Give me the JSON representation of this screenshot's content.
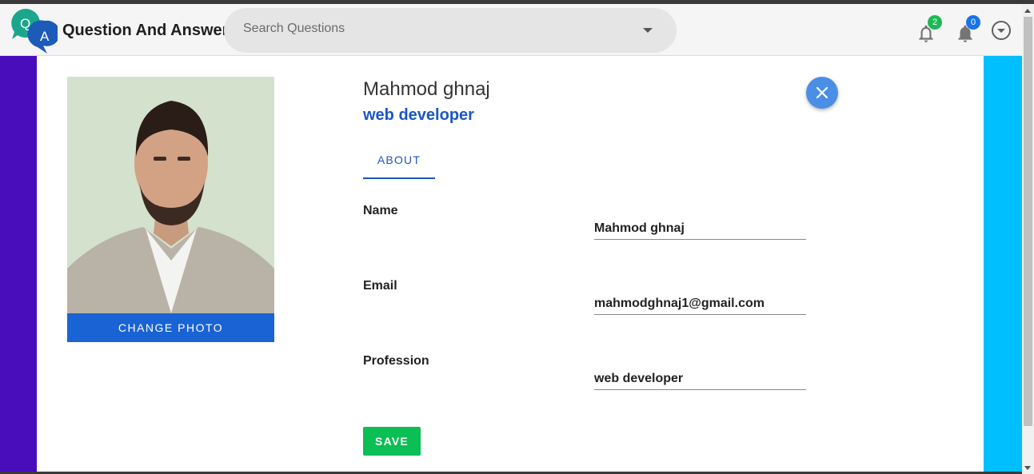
{
  "header": {
    "logo_letters": [
      "Q",
      "A"
    ],
    "app_title": "Question And Answer",
    "search": {
      "placeholder": "Search Questions",
      "icon": "chevron-down-icon"
    },
    "notifications": [
      {
        "icon": "bell-outline-icon",
        "count": "2",
        "badge_color": "#1db954"
      },
      {
        "icon": "bell-filled-icon",
        "count": "0",
        "badge_color": "#1a73e8"
      }
    ],
    "account_menu_icon": "circle-chevron-down-icon"
  },
  "profile": {
    "name": "Mahmod ghnaj",
    "profession": "web developer",
    "change_photo_label": "CHANGE PHOTO",
    "close_icon": "close-icon",
    "tabs": [
      {
        "label": "ABOUT",
        "active": true
      }
    ],
    "fields": [
      {
        "label": "Name",
        "value": "Mahmod ghnaj"
      },
      {
        "label": "Email",
        "value": "mahmodghnaj1@gmail.com"
      },
      {
        "label": "Profession",
        "value": "web developer"
      }
    ],
    "save_label": "SAVE"
  },
  "colors": {
    "accent_blue": "#1a56c4",
    "button_blue": "#1a63d4",
    "save_green": "#0abf53",
    "bg_left_purple": "#4a0dbc",
    "bg_right_cyan": "#00bfff"
  }
}
